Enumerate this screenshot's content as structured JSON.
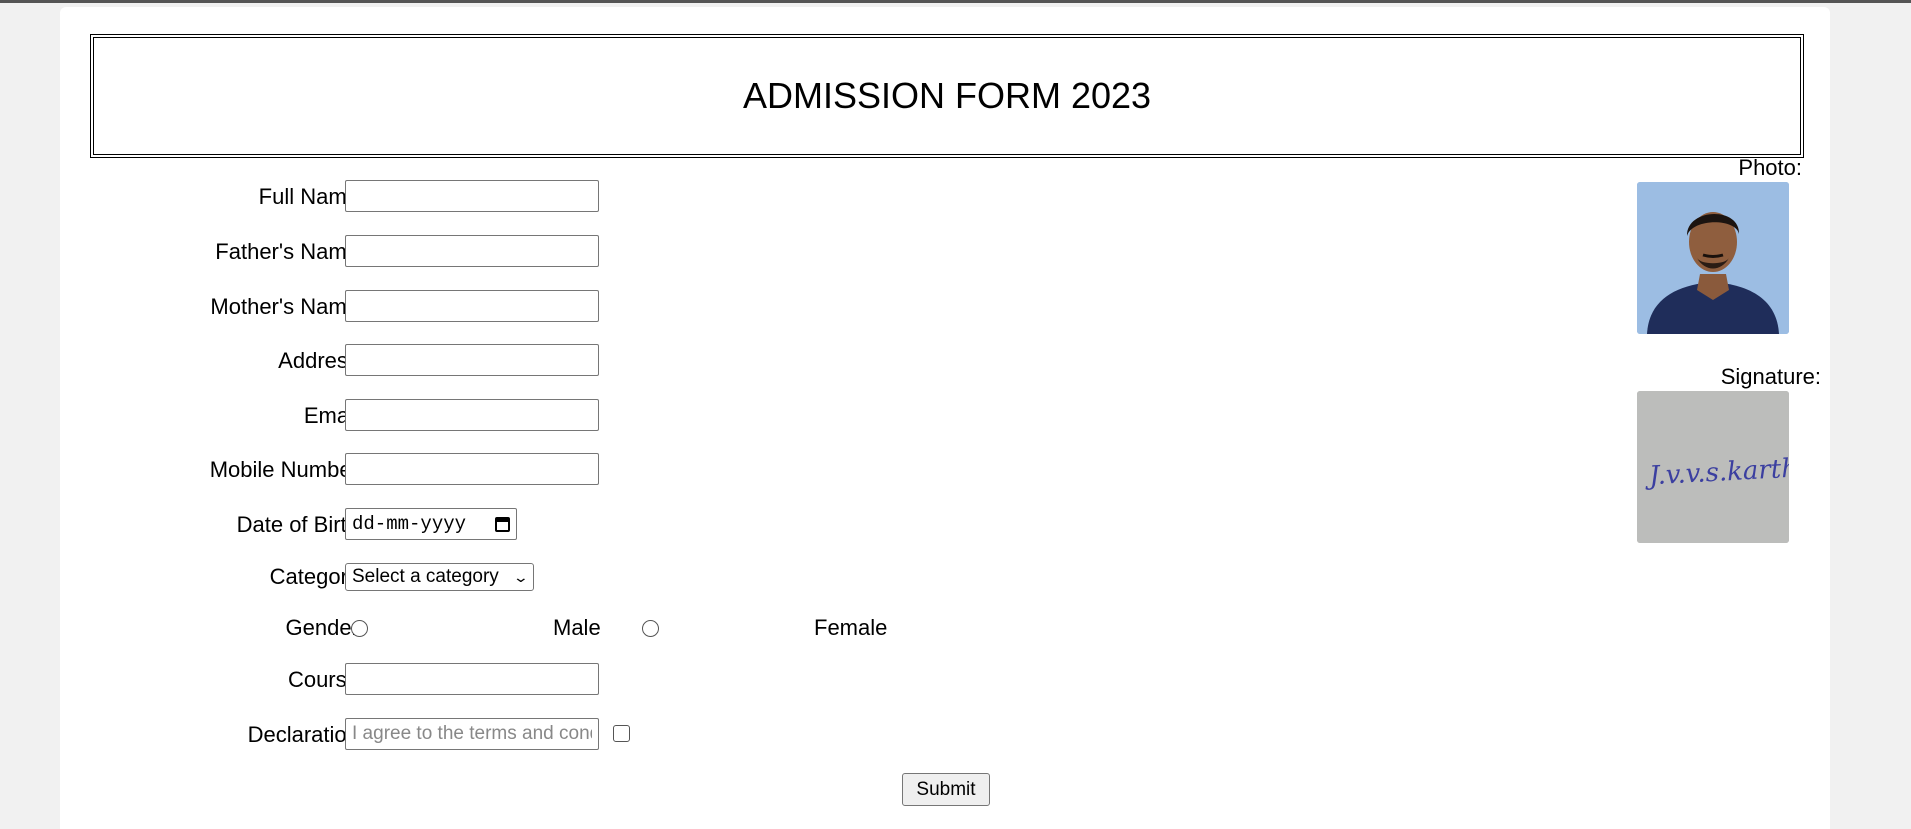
{
  "form": {
    "title": "ADMISSION FORM 2023",
    "fields": {
      "full_name": "Full Name:",
      "father_name": "Father's Name:",
      "mother_name": "Mother's Name:",
      "address": "Address:",
      "email": "Email:",
      "mobile": "Mobile Number:",
      "dob": "Date of Birth:",
      "category": "Category:",
      "gender": "Gender:",
      "course": "Course:",
      "declaration": "Declaration:"
    },
    "dob_placeholder": "dd-mm-yyyy",
    "category_selected": "Select a category",
    "gender_options": {
      "male": "Male",
      "female": "Female"
    },
    "declaration_placeholder": "I agree to the terms and conditions",
    "submit_label": "Submit"
  },
  "side": {
    "photo_label": "Photo:",
    "signature_label": "Signature:",
    "signature_text": "J.v.v.s.karthik"
  },
  "icons": {
    "dob": "calendar-icon",
    "category": "chevron-down-icon"
  },
  "colors": {
    "page_bg": "#f1f1f1",
    "card_bg": "#ffffff",
    "photo_bg": "#9cbde3",
    "signature_ink": "#3b3fa0"
  }
}
